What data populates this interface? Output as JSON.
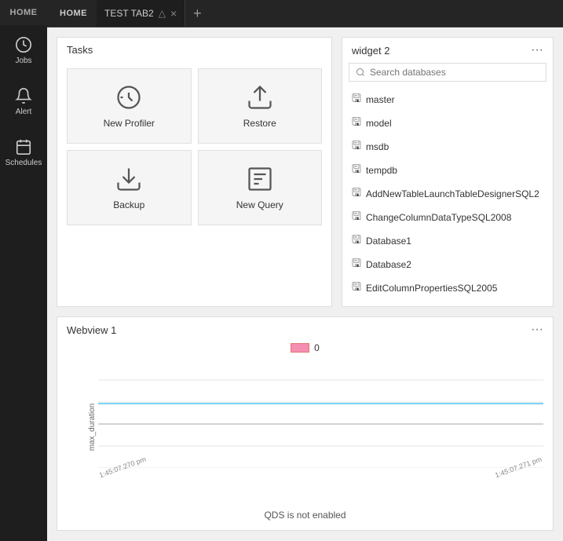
{
  "sidebar": {
    "home_label": "HOME",
    "items": [
      {
        "id": "jobs",
        "label": "Jobs",
        "icon": "jobs"
      },
      {
        "id": "alert",
        "label": "Alert",
        "icon": "alert"
      },
      {
        "id": "schedules",
        "label": "Schedules",
        "icon": "schedules"
      }
    ]
  },
  "tabs": {
    "home": "HOME",
    "active_tab": {
      "name": "TEST TAB2",
      "close_icon": "×",
      "pin_icon": "⊙"
    },
    "add_icon": "+"
  },
  "tasks_widget": {
    "title": "Tasks",
    "cards": [
      {
        "id": "new-profiler",
        "label": "New Profiler"
      },
      {
        "id": "restore",
        "label": "Restore"
      },
      {
        "id": "backup",
        "label": "Backup"
      },
      {
        "id": "new-query",
        "label": "New Query"
      }
    ]
  },
  "db_widget": {
    "title": "widget 2",
    "search_placeholder": "Search databases",
    "databases": [
      "master",
      "model",
      "msdb",
      "tempdb",
      "AddNewTableLaunchTableDesignerSQL2",
      "ChangeColumnDataTypeSQL2008",
      "Database1",
      "Database2",
      "EditColumnPropertiesSQL2005"
    ]
  },
  "webview_widget": {
    "title": "Webview 1",
    "legend_label": "0",
    "y_axis_label": "max_duration",
    "x_label_left": "1:45:07.270 pm",
    "x_label_right": "1:45:07.271 pm",
    "subtitle": "QDS is not enabled",
    "chart_line_value": 0.5
  },
  "more_icon": "···"
}
